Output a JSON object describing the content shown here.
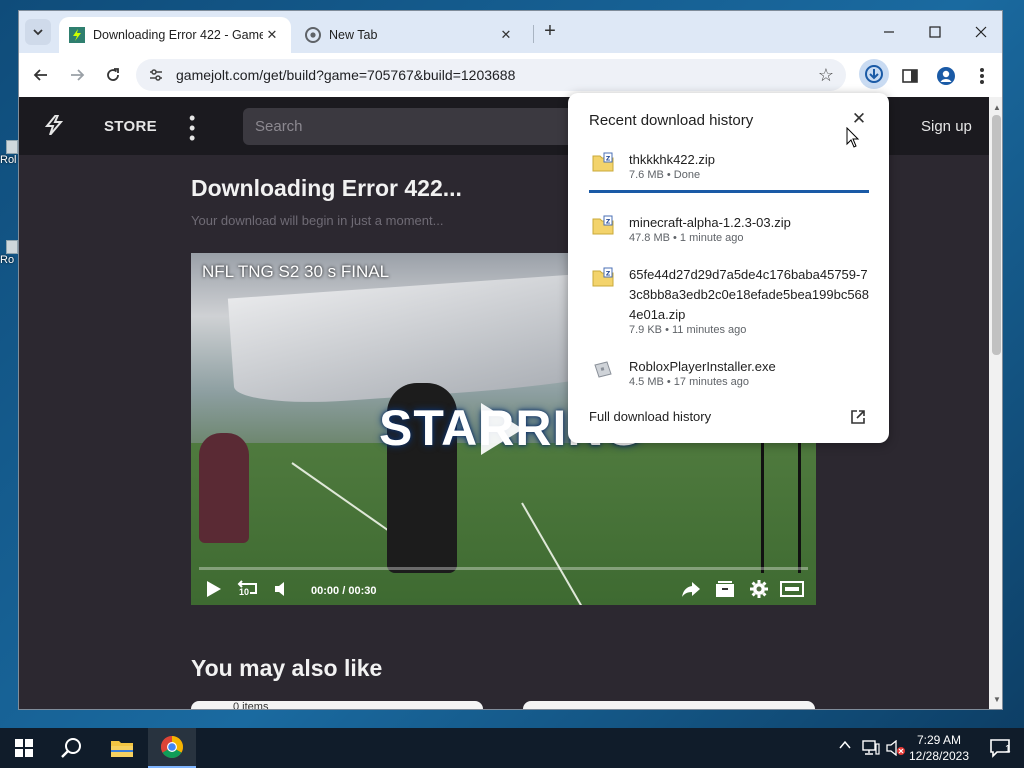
{
  "desktop": {
    "icons": [
      {
        "label": "Rol"
      },
      {
        "label": "Ro"
      }
    ]
  },
  "browser": {
    "tabs": [
      {
        "title": "Downloading Error 422 - Game",
        "active": true
      },
      {
        "title": "New Tab",
        "active": false
      }
    ],
    "address": "gamejolt.com/get/build?game=705767&build=1203688"
  },
  "site": {
    "nav": {
      "store": "STORE",
      "search_placeholder": "Search",
      "sign_up": "Sign up"
    },
    "heading": "Downloading Error 422...",
    "subheading": "Your download will begin in just a moment...",
    "video": {
      "title": "NFL TNG S2 30 s FINAL",
      "overlay_text": "STARRING",
      "current_time": "00:00",
      "separator": "/",
      "duration": "00:30",
      "replay_label": "10",
      "progress": 0
    },
    "also_heading": "You may also like",
    "card_caption": "0 items"
  },
  "downloads": {
    "title": "Recent download history",
    "items": [
      {
        "name": "thkkkhk422.zip",
        "meta": "7.6 MB • Done",
        "type": "zip"
      },
      {
        "name": "minecraft-alpha-1.2.3-03.zip",
        "meta": "47.8 MB • 1 minute ago",
        "type": "zip"
      },
      {
        "name": "65fe44d27d29d7a5de4c176baba45759-73c8bb8a3edb2c0e18efade5bea199bc5684e01a.zip",
        "meta": "7.9 KB • 11 minutes ago",
        "type": "zip"
      },
      {
        "name": "RobloxPlayerInstaller.exe",
        "meta": "4.5 MB • 17 minutes ago",
        "type": "exe"
      }
    ],
    "footer": "Full download history"
  },
  "taskbar": {
    "time": "7:29 AM",
    "date": "12/28/2023",
    "notification_count": "1"
  },
  "colors": {
    "accent": "#1a5aa6",
    "page_bg": "#2c2830",
    "nav_bg": "#1b1a1f",
    "tabstrip": "#dee8f6"
  }
}
